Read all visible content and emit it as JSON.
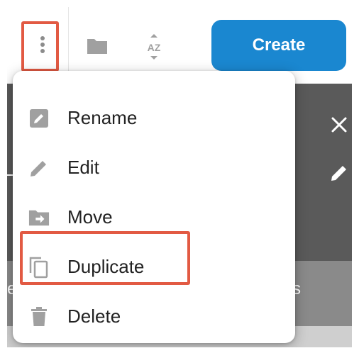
{
  "toolbar": {
    "more_icon": "more-vertical-icon",
    "folder_icon": "folder-icon",
    "sort_icon": "sort-alpha-icon",
    "sort_glyph": "AZ",
    "create_label": "Create"
  },
  "background": {
    "left_fragment": "e",
    "right_fragment": "s"
  },
  "menu": {
    "items": [
      {
        "label": "Rename",
        "icon": "rename-icon"
      },
      {
        "label": "Edit",
        "icon": "pencil-icon"
      },
      {
        "label": "Move",
        "icon": "move-folder-icon"
      },
      {
        "label": "Duplicate",
        "icon": "copy-icon"
      },
      {
        "label": "Delete",
        "icon": "trash-icon"
      }
    ]
  },
  "colors": {
    "accent": "#1a87d0",
    "highlight": "#e25a43",
    "overlay_dark": "#5a5a5a",
    "icon_gray": "#a0a0a0"
  }
}
